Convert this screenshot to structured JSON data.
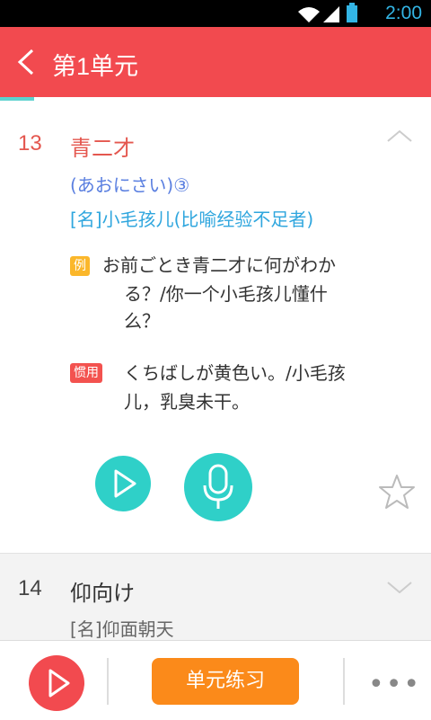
{
  "status": {
    "time": "2:00"
  },
  "header": {
    "title": "第1单元"
  },
  "progress_fraction": 0.08,
  "entries": [
    {
      "number": "13",
      "word": "青二才",
      "reading": "(あおにさい)③",
      "meaning": "[名]小毛孩儿(比喻经验不足者)",
      "example_tag": "例",
      "example_line1": "お前ごとき青二才に何がわか",
      "example_line2": "る？/你一个小毛孩儿懂什",
      "example_line3": "么？",
      "idiom_tag": "惯用",
      "idiom_line1": "くちばしが黄色い。/小毛孩",
      "idiom_line2": "儿，乳臭未干。"
    },
    {
      "number": "14",
      "word": "仰向け",
      "meaning": "[名]仰面朝天"
    }
  ],
  "bottom": {
    "practice_label": "单元练习",
    "more_label": "•••"
  },
  "colors": {
    "accent": "#f24a4f",
    "teal": "#2fd0c8",
    "orange": "#fb8a1a"
  }
}
